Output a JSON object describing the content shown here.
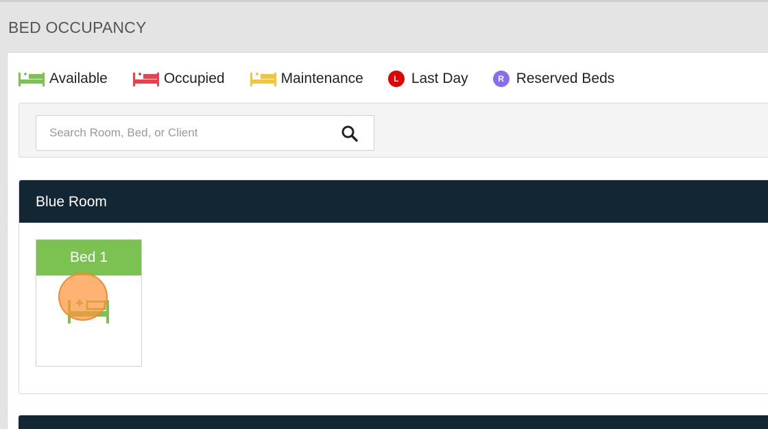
{
  "page": {
    "title": "BED OCCUPANCY"
  },
  "legend": [
    {
      "label": "Available",
      "icon": "bed-available-icon",
      "color": "#7bc253"
    },
    {
      "label": "Occupied",
      "icon": "bed-occupied-icon",
      "color": "#e8424f"
    },
    {
      "label": "Maintenance",
      "icon": "bed-maintenance-icon",
      "color": "#f2c63a"
    },
    {
      "label": "Last Day",
      "icon": "last-day-icon",
      "badge": "L",
      "color": "#e00000"
    },
    {
      "label": "Reserved Beds",
      "icon": "reserved-icon",
      "badge": "R",
      "color": "#8b6cf0"
    }
  ],
  "search": {
    "placeholder": "Search Room, Bed, or Client",
    "value": "",
    "icon": "search-icon"
  },
  "rooms": [
    {
      "name": "Blue Room",
      "beds": [
        {
          "label": "Bed 1",
          "status": "available",
          "icon": "add-bed-icon"
        }
      ]
    }
  ],
  "colors": {
    "header_bg": "#e4e4e4",
    "room_header_bg": "#122633",
    "available": "#7bc253",
    "occupied": "#e8424f",
    "maintenance": "#f2c63a"
  }
}
